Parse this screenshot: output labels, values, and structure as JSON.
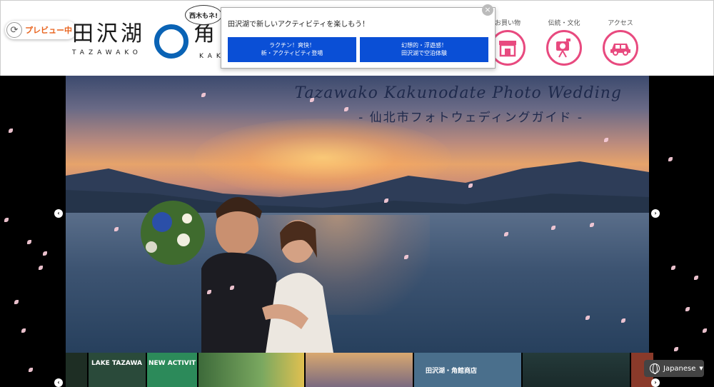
{
  "preview": {
    "label": "プレビュー中"
  },
  "logo": {
    "jp": "田沢湖",
    "en": "TAZAWAKO",
    "jp2": "角",
    "en2": "KAK",
    "bubble": "西木もネ!"
  },
  "nav": [
    {
      "label": "お買い物",
      "icon": "shop-icon"
    },
    {
      "label": "伝統・文化",
      "icon": "camera-icon"
    },
    {
      "label": "アクセス",
      "icon": "car-icon"
    }
  ],
  "popup": {
    "title": "田沢湖で新しいアクティビティを楽しもう！",
    "close": "×",
    "buttons": [
      {
        "line1": "ラクチン！爽快！",
        "line2": "新・アクティビティ登場"
      },
      {
        "line1": "幻想的・浮遊感！",
        "line2": "田沢湖で空泊体験"
      }
    ]
  },
  "hero": {
    "title": "Tazawako Kakunodate Photo Wedding",
    "subtitle": "- 仙北市フォトウェディングガイド -"
  },
  "thumbnails": [
    {
      "text": "LAKE TAZAWA",
      "color": "#2a4a3a"
    },
    {
      "text": "NEW ACTIVIT",
      "color": "#2c8a5a"
    },
    {
      "text": "",
      "color": "#3d5a3a"
    },
    {
      "text": "",
      "color": "#c9a878"
    },
    {
      "text": "田沢湖・角館商店",
      "color": "#4a6f8c"
    },
    {
      "text": "",
      "color": "#243a3a"
    },
    {
      "text": "",
      "color": "#8a3a2a"
    }
  ],
  "language": {
    "label": "Japanese"
  },
  "colors": {
    "accent_pink": "#e84a7f",
    "popup_blue": "#0a4fd6",
    "logo_blue": "#0a63b5",
    "preview_orange": "#e8621c"
  }
}
